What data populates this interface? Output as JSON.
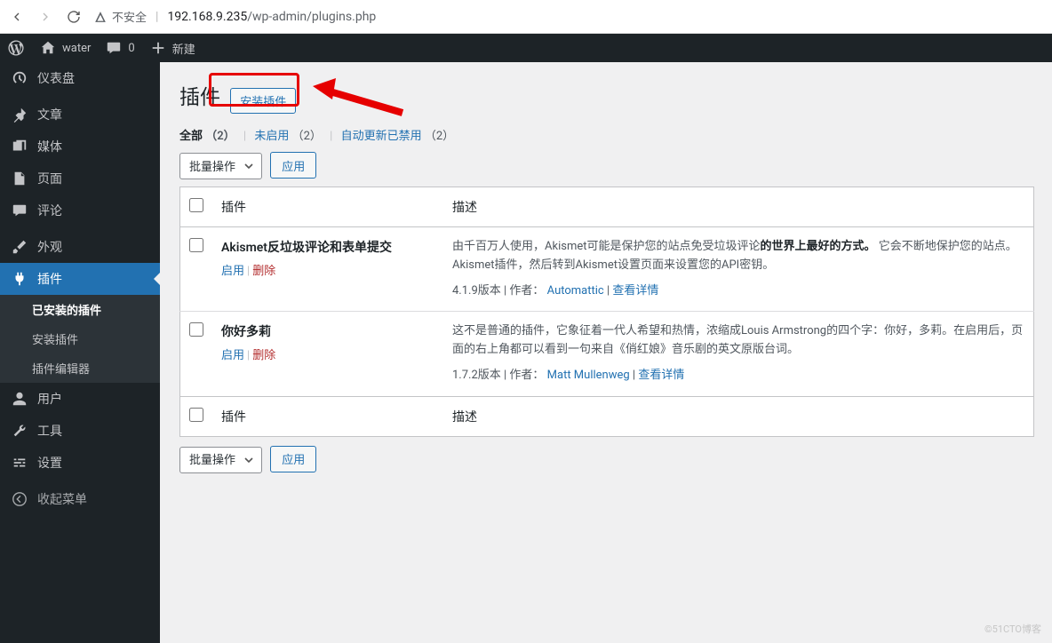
{
  "browser": {
    "insecure_label": "不安全",
    "host": "192.168.9.235",
    "path": "/wp-admin/plugins.php"
  },
  "adminbar": {
    "site_name": "water",
    "comments_count": "0",
    "new_label": "新建"
  },
  "menu": {
    "dashboard": "仪表盘",
    "posts": "文章",
    "media": "媒体",
    "pages": "页面",
    "comments": "评论",
    "appearance": "外观",
    "plugins": "插件",
    "users": "用户",
    "tools": "工具",
    "settings": "设置",
    "collapse": "收起菜单",
    "plugins_submenu": {
      "installed": "已安装的插件",
      "add_new": "安装插件",
      "editor": "插件编辑器"
    }
  },
  "page": {
    "title": "插件",
    "add_new_button": "安装插件",
    "filters": {
      "all_label": "全部",
      "all_count": "（2）",
      "inactive_label": "未启用",
      "inactive_count": "（2）",
      "auto_disabled_label": "自动更新已禁用",
      "auto_disabled_count": "（2）"
    },
    "bulk_label": "批量操作",
    "apply_label": "应用",
    "headers": {
      "plugin": "插件",
      "description": "描述"
    },
    "plugins": [
      {
        "name": "Akismet反垃圾评论和表单提交",
        "activate": "启用",
        "delete": "删除",
        "desc_pre": "由千百万人使用，Akismet可能是保护您的站点免受垃圾评论",
        "desc_strong": "的世界上最好的方式。",
        "desc_post": " 它会不断地保护您的站点。Akismet插件，然后转到Akismet设置页面来设置您的API密钥。",
        "version": "4.1.9版本",
        "by": "作者：",
        "author": "Automattic",
        "details": "查看详情"
      },
      {
        "name": "你好多莉",
        "activate": "启用",
        "delete": "删除",
        "desc_pre": "这不是普通的插件，它象征着一代人希望和热情，浓缩成Louis Armstrong的四个字：你好，多莉。在启用后，页面的右上角都可以看到一句来自《俏红娘》音乐剧的英文原版台词。",
        "desc_strong": "",
        "desc_post": "",
        "version": "1.7.2版本",
        "by": "作者：",
        "author": "Matt Mullenweg",
        "details": "查看详情"
      }
    ]
  },
  "watermark": "©51CTO博客"
}
